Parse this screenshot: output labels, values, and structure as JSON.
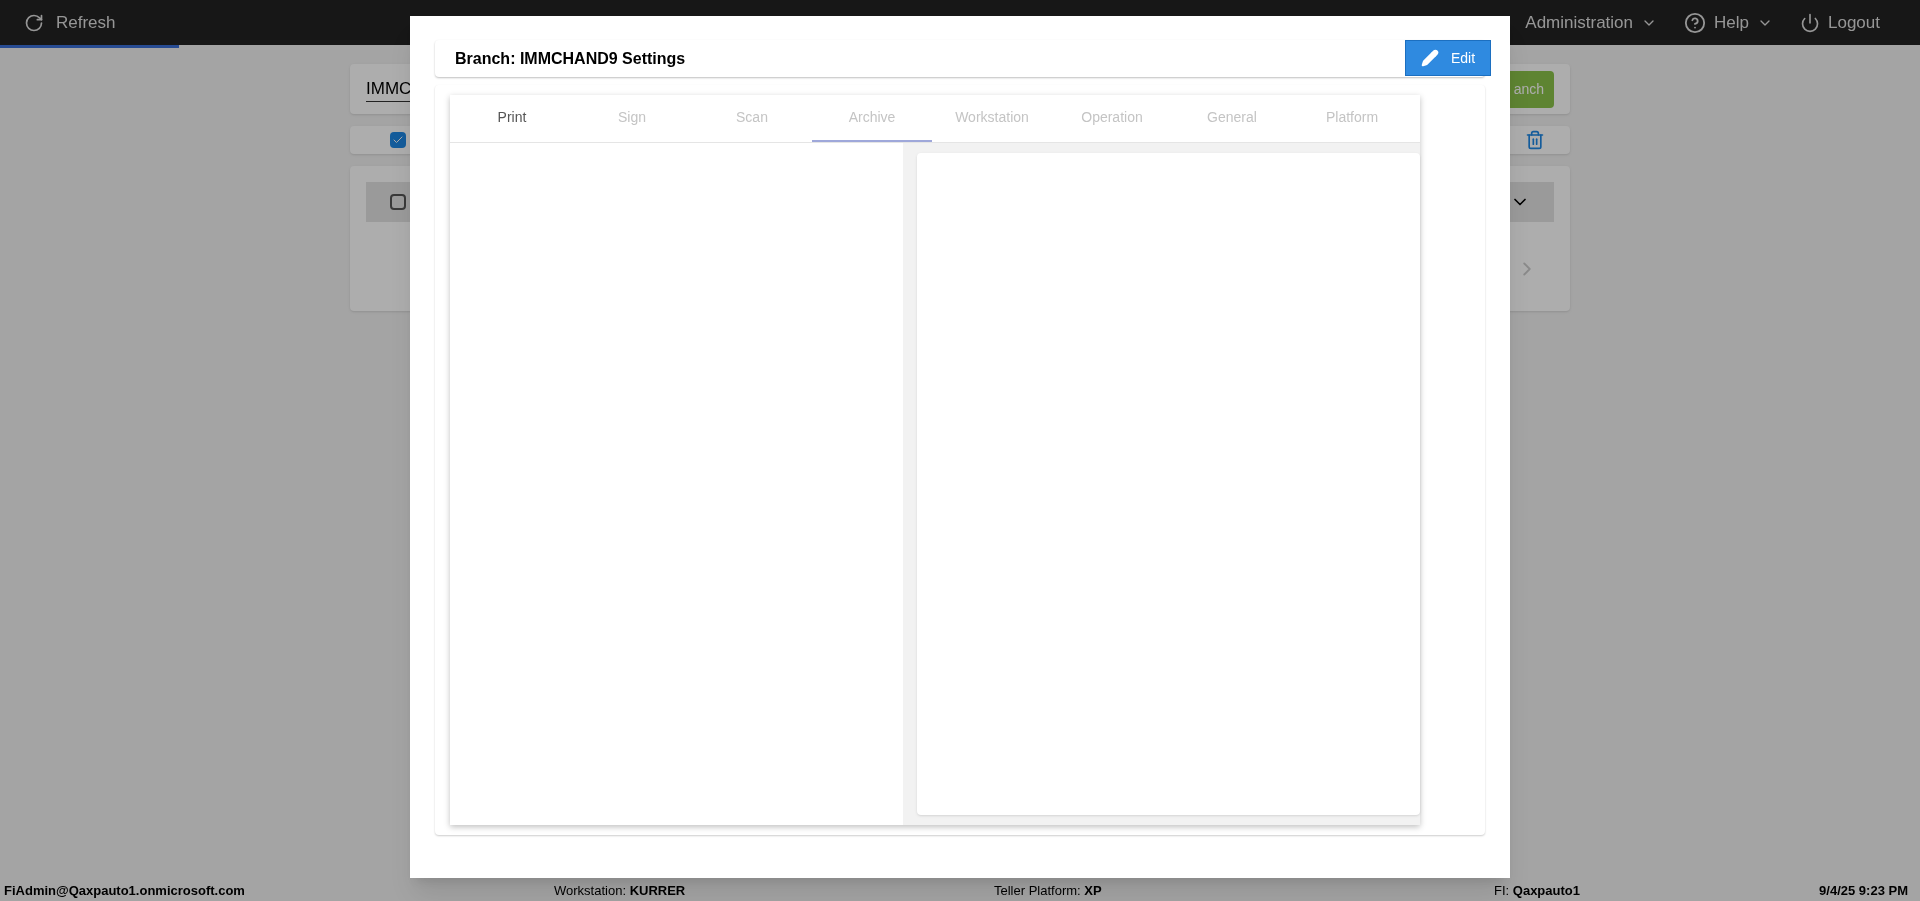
{
  "top_bar": {
    "refresh": "Refresh",
    "menus": [
      {
        "label": "Administration",
        "kind": "dropdown"
      },
      {
        "label": "Help",
        "kind": "dropdown"
      },
      {
        "label": "Logout",
        "kind": "logout"
      }
    ]
  },
  "progress": {
    "level": 0.093
  },
  "background": {
    "search_value": "IMMC",
    "add_button": "anch",
    "select_all_checked": true,
    "row_checked": false
  },
  "dialog": {
    "title": "Branch: IMMCHAND9 Settings",
    "edit_button": "Edit",
    "tabs": [
      {
        "label": "Print",
        "selected": false,
        "disabled": false
      },
      {
        "label": "Sign",
        "selected": false,
        "disabled": true
      },
      {
        "label": "Scan",
        "selected": false,
        "disabled": true
      },
      {
        "label": "Archive",
        "selected": true,
        "disabled": true
      },
      {
        "label": "Workstation",
        "selected": false,
        "disabled": true
      },
      {
        "label": "Operation",
        "selected": false,
        "disabled": true
      },
      {
        "label": "General",
        "selected": false,
        "disabled": true
      },
      {
        "label": "Platform",
        "selected": false,
        "disabled": true
      }
    ]
  },
  "status_bar": {
    "user": "FiAdmin@Qaxpauto1.onmicrosoft.com",
    "workstation_label": "Workstation:",
    "workstation": "KURRER",
    "platform_label": "Teller Platform:",
    "platform": "XP",
    "fi_label": "FI:",
    "fi": "Qaxpauto1",
    "datetime": "9/4/25 9:23 PM"
  }
}
